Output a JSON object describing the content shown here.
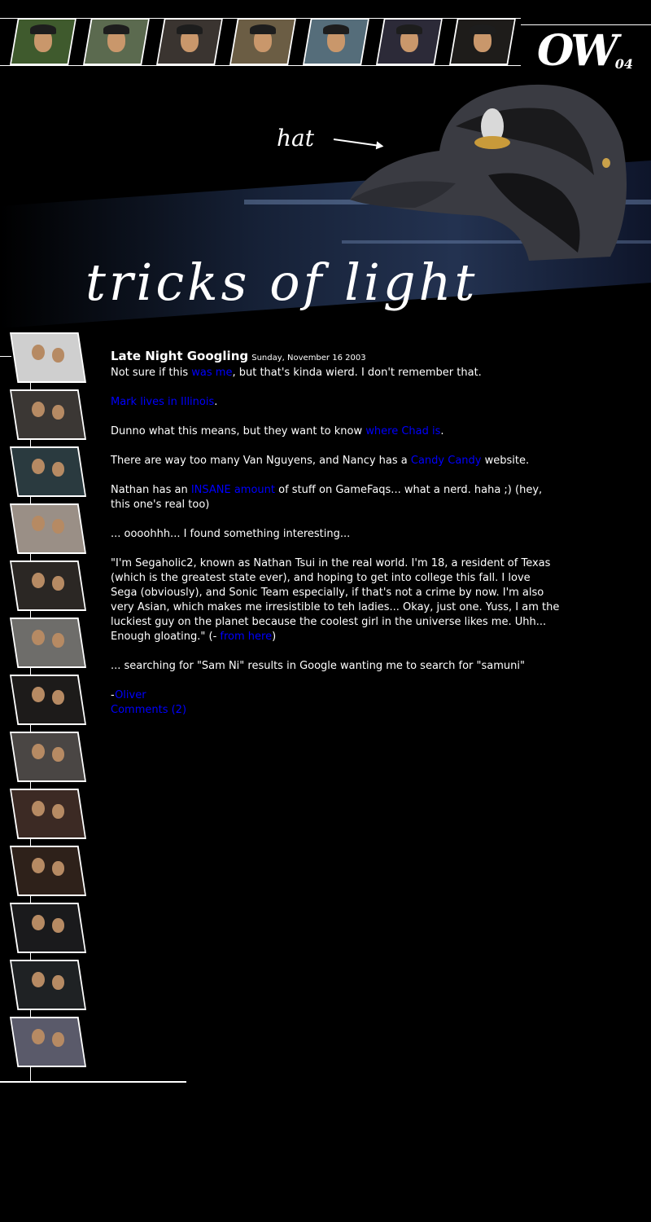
{
  "header": {
    "logo_text": "OW",
    "logo_year": "04",
    "hat_label": "hat",
    "site_title": "tricks of light",
    "top_thumbnails": [
      {
        "name": "thumb-1",
        "bg": "#3f5a2d"
      },
      {
        "name": "thumb-2",
        "bg": "#5b6a4f"
      },
      {
        "name": "thumb-3",
        "bg": "#3a3430"
      },
      {
        "name": "thumb-4",
        "bg": "#6b5d44"
      },
      {
        "name": "thumb-5",
        "bg": "#556d7a"
      },
      {
        "name": "thumb-6",
        "bg": "#2c2a38"
      },
      {
        "name": "thumb-7",
        "bg": "#1e1c1a"
      }
    ]
  },
  "sidebar": {
    "photos": [
      {
        "bg": "#cfcfcf"
      },
      {
        "bg": "#3b3734"
      },
      {
        "bg": "#2a3a3f"
      },
      {
        "bg": "#9a8f86"
      },
      {
        "bg": "#2b2724"
      },
      {
        "bg": "#6e6d6a"
      },
      {
        "bg": "#1d1b1a"
      },
      {
        "bg": "#4a4644"
      },
      {
        "bg": "#3c2a24"
      },
      {
        "bg": "#2e211a"
      },
      {
        "bg": "#1a1a1c"
      },
      {
        "bg": "#1f2224"
      },
      {
        "bg": "#5a5a6a"
      }
    ]
  },
  "post": {
    "title": "Late Night Googling",
    "date": "Sunday, November 16 2003",
    "p1_a": "Not sure if this ",
    "p1_link": "was me",
    "p1_b": ", but that's kinda wierd. I don't remember that.",
    "p2_link": "Mark lives in Illinois",
    "p2_b": ".",
    "p3_a": "Dunno what this means, but they want to know ",
    "p3_link": "where Chad is",
    "p3_b": ".",
    "p4_a": "There are way too many Van Nguyens, and Nancy has a ",
    "p4_link": "Candy Candy",
    "p4_b": " website.",
    "p5_a": "Nathan has an ",
    "p5_link": "INSANE amount",
    "p5_b": " of stuff on GameFaqs... what a nerd. haha ;) (hey, this one's real too)",
    "p6": "... oooohhh... I found something interesting...",
    "p7_a": "\"I'm Segaholic2, known as Nathan Tsui in the real world. I'm 18, a resident of Texas (which is the greatest state ever), and hoping to get into college this fall. I love Sega (obviously), and Sonic Team especially, if that's not a crime by now. I'm also very Asian, which makes me irresistible to teh ladies... Okay, just one. Yuss, I am the luckiest guy on the planet because the coolest girl in the universe likes me. Uhh... Enough gloating.\" (- ",
    "p7_link": "from here",
    "p7_b": ")",
    "p8": "... searching for \"Sam Ni\" results in Google wanting me to search for \"samuni\"",
    "signature_dash": "-",
    "author_link": "Oliver",
    "comments_link": "Comments (2)"
  },
  "colors": {
    "link": "#0000ff",
    "background": "#000000",
    "text": "#ffffff"
  }
}
